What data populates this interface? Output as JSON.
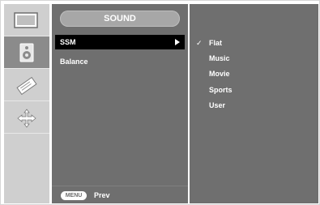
{
  "header": {
    "title": "SOUND"
  },
  "sidebar": {
    "items": [
      {
        "icon": "picture-icon"
      },
      {
        "icon": "speaker-icon",
        "selected": true
      },
      {
        "icon": "tag-icon"
      },
      {
        "icon": "move-icon"
      }
    ]
  },
  "menu": {
    "items": [
      {
        "label": "SSM",
        "selected": true
      },
      {
        "label": "Balance"
      }
    ]
  },
  "submenu": {
    "check_mark": "✓",
    "options": [
      "Flat",
      "Music",
      "Movie",
      "Sports",
      "User"
    ],
    "checked_index": 0
  },
  "footer": {
    "menu_key": "MENU",
    "prev_label": "Prev"
  }
}
